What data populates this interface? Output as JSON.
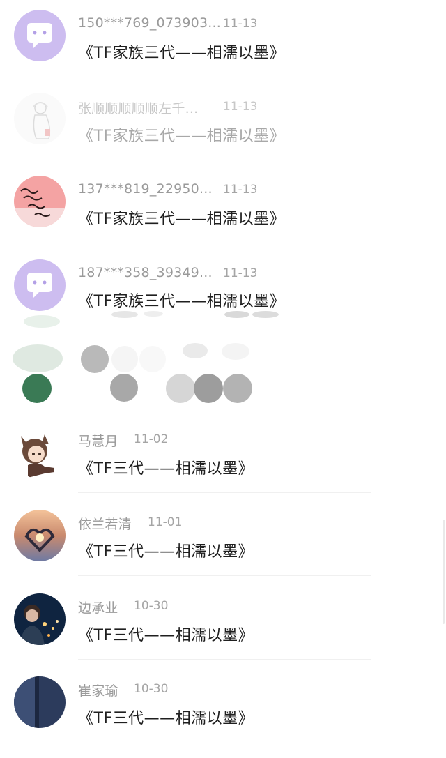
{
  "comments": [
    {
      "name": "150***769_073903...",
      "date": "11-13",
      "text": "《TF家族三代——相濡以墨》",
      "avatar": "purple-chat-bubble",
      "faded": false
    },
    {
      "name": "张顺顺顺顺顺左千...",
      "date": "11-13",
      "text": "《TF家族三代——相濡以墨》",
      "avatar": "sketch-girl",
      "faded": true
    },
    {
      "name": "137***819_22950...",
      "date": "11-13",
      "text": "《TF家族三代——相濡以墨》",
      "avatar": "handwriting-red-note",
      "faded": false
    },
    {
      "name": "187***358_39349...",
      "date": "11-13",
      "text": "《TF家族三代——相濡以墨》",
      "avatar": "purple-chat-bubble",
      "faded": false
    },
    {
      "name": "马慧月",
      "date": "11-02",
      "text": "《TF三代——相濡以墨》",
      "avatar": "cartoon-girl-cat-ears",
      "faded": false
    },
    {
      "name": "依兰若清",
      "date": "11-01",
      "text": "《TF三代——相濡以墨》",
      "avatar": "sunset-heart-hands",
      "faded": false
    },
    {
      "name": "边承业",
      "date": "10-30",
      "text": "《TF三代——相濡以墨》",
      "avatar": "night-portrait",
      "faded": false
    },
    {
      "name": "崔家瑜",
      "date": "10-30",
      "text": "《TF三代——相濡以墨》",
      "avatar": "dark-blue-photo",
      "faded": false
    }
  ],
  "colors": {
    "accent_purple": "#cdbdf0",
    "name_gray": "#9a9a9a",
    "text_dark": "#1f1f1f"
  }
}
